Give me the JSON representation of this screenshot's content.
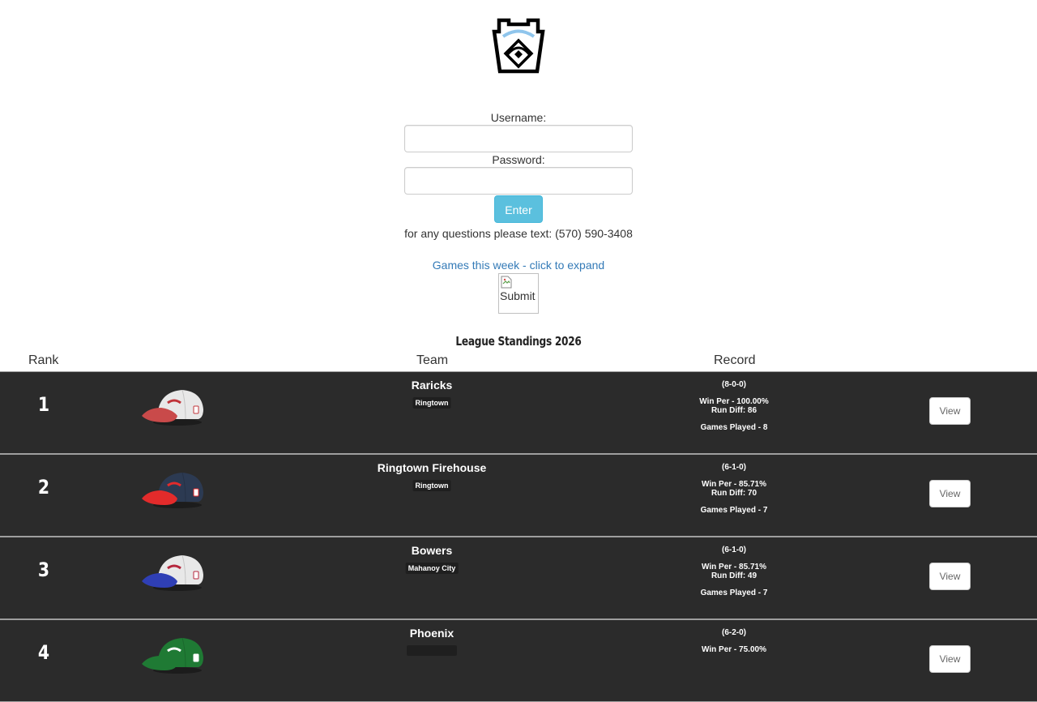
{
  "login": {
    "username_label": "Username:",
    "username_value": "",
    "password_label": "Password:",
    "password_value": "",
    "enter_label": "Enter",
    "contact_text": "for any questions please text: (570) 590-3408"
  },
  "games_link": "Games this week - click to expand",
  "submit_image": {
    "alt": "Submit"
  },
  "standings": {
    "title": "League Standings 2026",
    "headers": {
      "rank": "Rank",
      "team": "Team",
      "record": "Record"
    },
    "rows": [
      {
        "rank": "1",
        "team": "Raricks",
        "town": "Ringtown",
        "record": "(8-0-0)",
        "win_per": "Win Per - 100.00%",
        "run_diff": "Run Diff: 86",
        "games_played": "Games Played - 8",
        "view_label": "View",
        "cap": {
          "crown": "#e8e8e8",
          "brim": "#c94a4a",
          "logo": "#c0343a"
        }
      },
      {
        "rank": "2",
        "team": "Ringtown Firehouse",
        "town": "Ringtown",
        "record": "(6-1-0)",
        "win_per": "Win Per - 85.71%",
        "run_diff": "Run Diff: 70",
        "games_played": "Games Played - 7",
        "view_label": "View",
        "cap": {
          "crown": "#2c3a52",
          "brim": "#e32b2b",
          "logo": "#e32b2b"
        }
      },
      {
        "rank": "3",
        "team": "Bowers",
        "town": "Mahanoy City",
        "record": "(6-1-0)",
        "win_per": "Win Per - 85.71%",
        "run_diff": "Run Diff: 49",
        "games_played": "Games Played - 7",
        "view_label": "View",
        "cap": {
          "crown": "#e8e8e8",
          "brim": "#2f3fb5",
          "logo": "#b5263c"
        }
      },
      {
        "rank": "4",
        "team": "Phoenix",
        "town": "",
        "record": "(6-2-0)",
        "win_per": "Win Per - 75.00%",
        "run_diff": "",
        "games_played": "",
        "view_label": "View",
        "cap": {
          "crown": "#1f7a34",
          "brim": "#1f7a34",
          "logo": "#ffffff"
        }
      }
    ]
  }
}
